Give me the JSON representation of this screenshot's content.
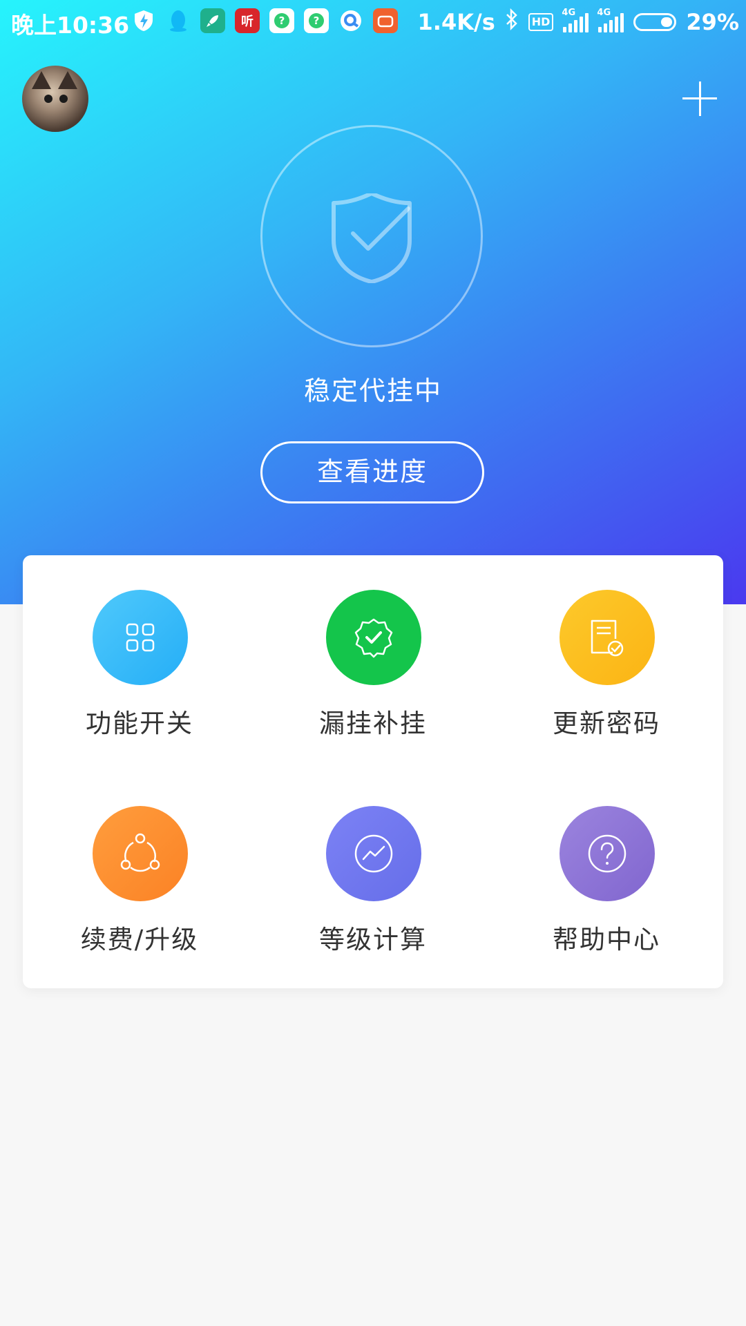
{
  "status_bar": {
    "time": "晚上10:36",
    "net_speed": "1.4K/s",
    "hd": "HD",
    "signal_label_1": "4G",
    "signal_label_2": "4G",
    "battery": "29%"
  },
  "header": {
    "avatar_icon": "cat-avatar",
    "add_icon": "plus-icon"
  },
  "hero": {
    "status": "稳定代挂中",
    "progress_button": "查看进度",
    "shield_icon": "shield-check-icon"
  },
  "grid": [
    {
      "label": "功能开关",
      "icon": "grid-apps-icon",
      "color": "#2fb8f9"
    },
    {
      "label": "漏挂补挂",
      "icon": "badge-check-icon",
      "color": "#14c54b"
    },
    {
      "label": "更新密码",
      "icon": "document-check-icon",
      "color": "#fcbe1e"
    },
    {
      "label": "续费/升级",
      "icon": "cycle-nodes-icon",
      "color": "#fc8f30"
    },
    {
      "label": "等级计算",
      "icon": "trend-chart-icon",
      "color": "#7076ef"
    },
    {
      "label": "帮助中心",
      "icon": "help-icon",
      "color": "#8c74d6"
    }
  ]
}
